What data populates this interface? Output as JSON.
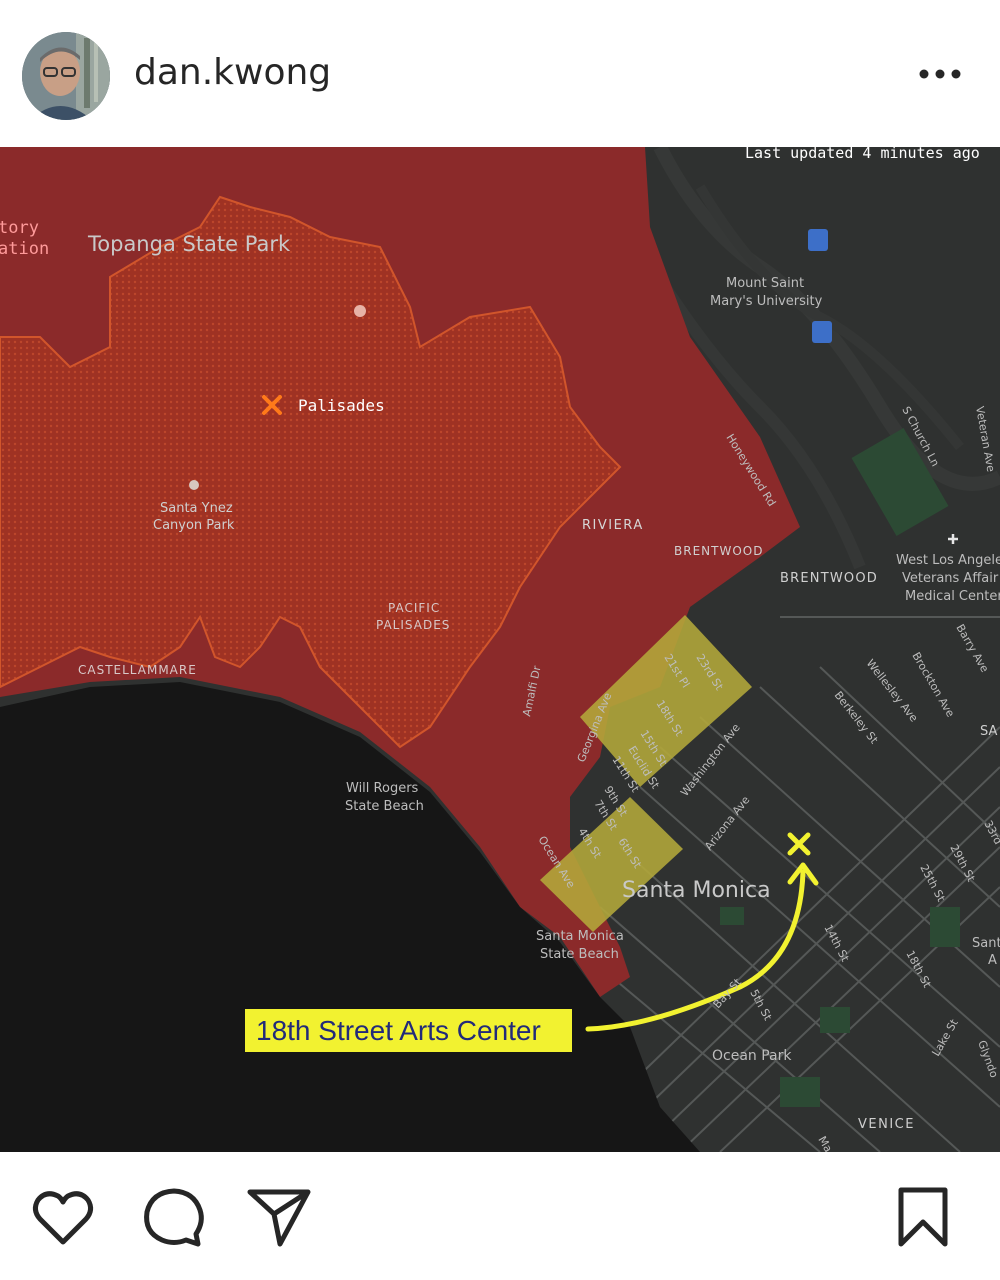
{
  "post": {
    "username": "dan.kwong"
  },
  "icons": {
    "avatar": "user-avatar",
    "more": "more-options-icon",
    "like": "heart-icon",
    "comment": "comment-bubble-icon",
    "share": "paper-plane-icon",
    "save": "bookmark-icon"
  },
  "map": {
    "last_updated": "Last updated 4 minutes ago",
    "order_fragment_1": "tory",
    "order_fragment_2": "ation",
    "fire_name": "Palisades",
    "annotation_label": "18th Street Arts Center",
    "colors": {
      "evac_order": "#8b2a2a",
      "warning_zone": "#b4a83a",
      "ocean": "#161616",
      "land": "#2f3130",
      "highlight": "#f2f230"
    },
    "places": {
      "topanga": "Topanga State Park",
      "mount_saint_1": "Mount Saint",
      "mount_saint_2": "Mary's University",
      "santa_ynez_1": "Santa Ynez",
      "santa_ynez_2": "Canyon Park",
      "riviera": "RIVIERA",
      "brentwood_1": "BRENTWOOD",
      "brentwood_2": "BRENTWOOD",
      "pacific_1": "PACIFIC",
      "pacific_2": "PALISADES",
      "castellammare": "CASTELLAMMARE",
      "will_rogers_1": "Will Rogers",
      "will_rogers_2": "State Beach",
      "santa_monica": "Santa Monica",
      "sm_beach_1": "Santa Monica",
      "sm_beach_2": "State Beach",
      "ocean_park": "Ocean Park",
      "venice": "VENICE",
      "west_la_1": "West Los Angele",
      "west_la_2": "Veterans Affair",
      "west_la_3": "Medical Center",
      "sa": "SA",
      "sant_1": "Sant",
      "sant_2": "A"
    },
    "streets": {
      "honeywood": "Honeywood Rd",
      "church": "S Church Ln",
      "veteran": "Veteran Ave",
      "barry": "Barry Ave",
      "brockton": "Brockton Ave",
      "wellesley": "Wellesley Ave",
      "berkeley": "Berkeley St",
      "amalfi": "Amalfi Dr",
      "georgina": "Georgina Ave",
      "st21": "21st Pl",
      "st23": "23rd St",
      "st18": "18th St",
      "st15": "15th St",
      "euclid": "Euclid St",
      "st11": "11th St",
      "st9": "9th St",
      "st7": "7th St",
      "st6": "6th St",
      "st4": "4th St",
      "ocean_ave": "Ocean Ave",
      "washington": "Washington Ave",
      "arizona": "Arizona Ave",
      "st14": "14th St",
      "st18b": "18th St",
      "st25": "25th St",
      "st29": "29th St",
      "st33": "33rd",
      "bay": "Bay St",
      "st5": "5th St",
      "lake": "Lake St",
      "glyndon": "Glyndo",
      "ma": "Ma"
    }
  }
}
